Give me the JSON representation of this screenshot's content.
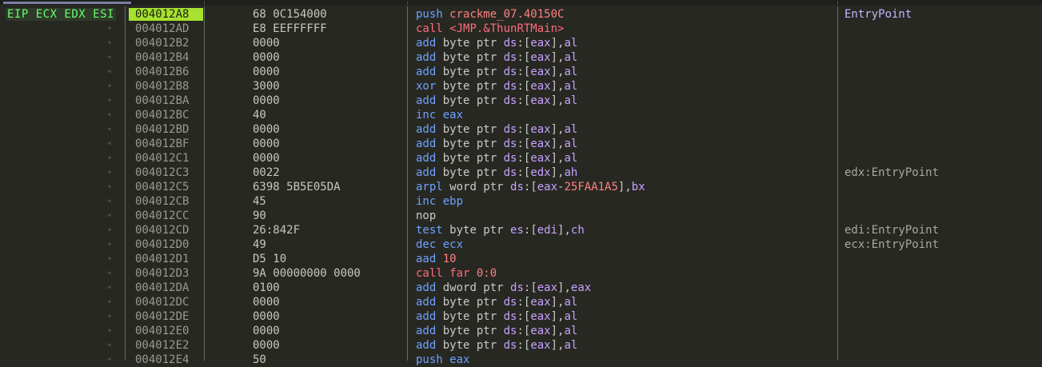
{
  "registers_label": "EIP ECX EDX ESI",
  "colors": {
    "background": "#272822",
    "current_address_highlight": "#a6e22e",
    "register_label": "#69ff6e",
    "mnemonic": "#6fa1ff",
    "call": "#ff6b7e",
    "segment_register": "#c8a2ff",
    "number": "#ff8080"
  },
  "rows": [
    {
      "addr": "004012A8",
      "bytes": "68 0C154000",
      "comment": "EntryPoint",
      "current": true,
      "tokens": [
        {
          "t": "push",
          "c": "mn"
        },
        {
          "t": " "
        },
        {
          "t": "crackme_07.40150C",
          "c": "sym"
        }
      ]
    },
    {
      "addr": "004012AD",
      "bytes": "E8 EEFFFFFF",
      "comment": "",
      "tokens": [
        {
          "t": "call",
          "c": "call"
        },
        {
          "t": " "
        },
        {
          "t": "<JMP.&ThunRTMain>",
          "c": "call"
        }
      ]
    },
    {
      "addr": "004012B2",
      "bytes": "0000",
      "comment": "",
      "tokens": [
        {
          "t": "add",
          "c": "mn"
        },
        {
          "t": " "
        },
        {
          "t": "byte ptr",
          "c": "sz"
        },
        {
          "t": " "
        },
        {
          "t": "ds",
          "c": "seg"
        },
        {
          "t": ":[",
          "c": "pun"
        },
        {
          "t": "eax",
          "c": "reg"
        },
        {
          "t": "],",
          "c": "pun"
        },
        {
          "t": "al",
          "c": "reg"
        }
      ]
    },
    {
      "addr": "004012B4",
      "bytes": "0000",
      "comment": "",
      "tokens": [
        {
          "t": "add",
          "c": "mn"
        },
        {
          "t": " "
        },
        {
          "t": "byte ptr",
          "c": "sz"
        },
        {
          "t": " "
        },
        {
          "t": "ds",
          "c": "seg"
        },
        {
          "t": ":[",
          "c": "pun"
        },
        {
          "t": "eax",
          "c": "reg"
        },
        {
          "t": "],",
          "c": "pun"
        },
        {
          "t": "al",
          "c": "reg"
        }
      ]
    },
    {
      "addr": "004012B6",
      "bytes": "0000",
      "comment": "",
      "tokens": [
        {
          "t": "add",
          "c": "mn"
        },
        {
          "t": " "
        },
        {
          "t": "byte ptr",
          "c": "sz"
        },
        {
          "t": " "
        },
        {
          "t": "ds",
          "c": "seg"
        },
        {
          "t": ":[",
          "c": "pun"
        },
        {
          "t": "eax",
          "c": "reg"
        },
        {
          "t": "],",
          "c": "pun"
        },
        {
          "t": "al",
          "c": "reg"
        }
      ]
    },
    {
      "addr": "004012B8",
      "bytes": "3000",
      "comment": "",
      "tokens": [
        {
          "t": "xor",
          "c": "mn"
        },
        {
          "t": " "
        },
        {
          "t": "byte ptr",
          "c": "sz"
        },
        {
          "t": " "
        },
        {
          "t": "ds",
          "c": "seg"
        },
        {
          "t": ":[",
          "c": "pun"
        },
        {
          "t": "eax",
          "c": "reg"
        },
        {
          "t": "],",
          "c": "pun"
        },
        {
          "t": "al",
          "c": "reg"
        }
      ]
    },
    {
      "addr": "004012BA",
      "bytes": "0000",
      "comment": "",
      "tokens": [
        {
          "t": "add",
          "c": "mn"
        },
        {
          "t": " "
        },
        {
          "t": "byte ptr",
          "c": "sz"
        },
        {
          "t": " "
        },
        {
          "t": "ds",
          "c": "seg"
        },
        {
          "t": ":[",
          "c": "pun"
        },
        {
          "t": "eax",
          "c": "reg"
        },
        {
          "t": "],",
          "c": "pun"
        },
        {
          "t": "al",
          "c": "reg"
        }
      ]
    },
    {
      "addr": "004012BC",
      "bytes": "40",
      "comment": "",
      "tokens": [
        {
          "t": "inc",
          "c": "mn"
        },
        {
          "t": " "
        },
        {
          "t": "eax",
          "c": "mn"
        }
      ]
    },
    {
      "addr": "004012BD",
      "bytes": "0000",
      "comment": "",
      "tokens": [
        {
          "t": "add",
          "c": "mn"
        },
        {
          "t": " "
        },
        {
          "t": "byte ptr",
          "c": "sz"
        },
        {
          "t": " "
        },
        {
          "t": "ds",
          "c": "seg"
        },
        {
          "t": ":[",
          "c": "pun"
        },
        {
          "t": "eax",
          "c": "reg"
        },
        {
          "t": "],",
          "c": "pun"
        },
        {
          "t": "al",
          "c": "reg"
        }
      ]
    },
    {
      "addr": "004012BF",
      "bytes": "0000",
      "comment": "",
      "tokens": [
        {
          "t": "add",
          "c": "mn"
        },
        {
          "t": " "
        },
        {
          "t": "byte ptr",
          "c": "sz"
        },
        {
          "t": " "
        },
        {
          "t": "ds",
          "c": "seg"
        },
        {
          "t": ":[",
          "c": "pun"
        },
        {
          "t": "eax",
          "c": "reg"
        },
        {
          "t": "],",
          "c": "pun"
        },
        {
          "t": "al",
          "c": "reg"
        }
      ]
    },
    {
      "addr": "004012C1",
      "bytes": "0000",
      "comment": "",
      "tokens": [
        {
          "t": "add",
          "c": "mn"
        },
        {
          "t": " "
        },
        {
          "t": "byte ptr",
          "c": "sz"
        },
        {
          "t": " "
        },
        {
          "t": "ds",
          "c": "seg"
        },
        {
          "t": ":[",
          "c": "pun"
        },
        {
          "t": "eax",
          "c": "reg"
        },
        {
          "t": "],",
          "c": "pun"
        },
        {
          "t": "al",
          "c": "reg"
        }
      ]
    },
    {
      "addr": "004012C3",
      "bytes": "0022",
      "comment": "edx:EntryPoint",
      "tokens": [
        {
          "t": "add",
          "c": "mn"
        },
        {
          "t": " "
        },
        {
          "t": "byte ptr",
          "c": "sz"
        },
        {
          "t": " "
        },
        {
          "t": "ds",
          "c": "seg"
        },
        {
          "t": ":[",
          "c": "pun"
        },
        {
          "t": "edx",
          "c": "reg"
        },
        {
          "t": "],",
          "c": "pun"
        },
        {
          "t": "ah",
          "c": "reg"
        }
      ]
    },
    {
      "addr": "004012C5",
      "bytes": "6398 5B5E05DA",
      "comment": "",
      "tokens": [
        {
          "t": "arpl",
          "c": "mn"
        },
        {
          "t": " "
        },
        {
          "t": "word ptr",
          "c": "sz"
        },
        {
          "t": " "
        },
        {
          "t": "ds",
          "c": "seg"
        },
        {
          "t": ":[",
          "c": "pun"
        },
        {
          "t": "eax",
          "c": "reg"
        },
        {
          "t": "-",
          "c": "pun"
        },
        {
          "t": "25FAA1A5",
          "c": "num"
        },
        {
          "t": "],",
          "c": "pun"
        },
        {
          "t": "bx",
          "c": "reg"
        }
      ]
    },
    {
      "addr": "004012CB",
      "bytes": "45",
      "comment": "",
      "tokens": [
        {
          "t": "inc",
          "c": "mn"
        },
        {
          "t": " "
        },
        {
          "t": "ebp",
          "c": "mn"
        }
      ]
    },
    {
      "addr": "004012CC",
      "bytes": "90",
      "comment": "",
      "tokens": [
        {
          "t": "nop",
          "c": "sz"
        }
      ]
    },
    {
      "addr": "004012CD",
      "bytes": "26:842F",
      "comment": "edi:EntryPoint",
      "tokens": [
        {
          "t": "test",
          "c": "mn"
        },
        {
          "t": " "
        },
        {
          "t": "byte ptr",
          "c": "sz"
        },
        {
          "t": " "
        },
        {
          "t": "es",
          "c": "seg"
        },
        {
          "t": ":[",
          "c": "pun"
        },
        {
          "t": "edi",
          "c": "reg"
        },
        {
          "t": "],",
          "c": "pun"
        },
        {
          "t": "ch",
          "c": "reg"
        }
      ]
    },
    {
      "addr": "004012D0",
      "bytes": "49",
      "comment": "ecx:EntryPoint",
      "tokens": [
        {
          "t": "dec",
          "c": "mn"
        },
        {
          "t": " "
        },
        {
          "t": "ecx",
          "c": "mn"
        }
      ]
    },
    {
      "addr": "004012D1",
      "bytes": "D5 10",
      "comment": "",
      "tokens": [
        {
          "t": "aad",
          "c": "mn"
        },
        {
          "t": " "
        },
        {
          "t": "10",
          "c": "num"
        }
      ]
    },
    {
      "addr": "004012D3",
      "bytes": "9A 00000000 0000",
      "comment": "",
      "tokens": [
        {
          "t": "call far",
          "c": "call"
        },
        {
          "t": " "
        },
        {
          "t": "0:0",
          "c": "num"
        }
      ]
    },
    {
      "addr": "004012DA",
      "bytes": "0100",
      "comment": "",
      "tokens": [
        {
          "t": "add",
          "c": "mn"
        },
        {
          "t": " "
        },
        {
          "t": "dword ptr",
          "c": "sz"
        },
        {
          "t": " "
        },
        {
          "t": "ds",
          "c": "seg"
        },
        {
          "t": ":[",
          "c": "pun"
        },
        {
          "t": "eax",
          "c": "reg"
        },
        {
          "t": "],",
          "c": "pun"
        },
        {
          "t": "eax",
          "c": "reg"
        }
      ]
    },
    {
      "addr": "004012DC",
      "bytes": "0000",
      "comment": "",
      "tokens": [
        {
          "t": "add",
          "c": "mn"
        },
        {
          "t": " "
        },
        {
          "t": "byte ptr",
          "c": "sz"
        },
        {
          "t": " "
        },
        {
          "t": "ds",
          "c": "seg"
        },
        {
          "t": ":[",
          "c": "pun"
        },
        {
          "t": "eax",
          "c": "reg"
        },
        {
          "t": "],",
          "c": "pun"
        },
        {
          "t": "al",
          "c": "reg"
        }
      ]
    },
    {
      "addr": "004012DE",
      "bytes": "0000",
      "comment": "",
      "tokens": [
        {
          "t": "add",
          "c": "mn"
        },
        {
          "t": " "
        },
        {
          "t": "byte ptr",
          "c": "sz"
        },
        {
          "t": " "
        },
        {
          "t": "ds",
          "c": "seg"
        },
        {
          "t": ":[",
          "c": "pun"
        },
        {
          "t": "eax",
          "c": "reg"
        },
        {
          "t": "],",
          "c": "pun"
        },
        {
          "t": "al",
          "c": "reg"
        }
      ]
    },
    {
      "addr": "004012E0",
      "bytes": "0000",
      "comment": "",
      "tokens": [
        {
          "t": "add",
          "c": "mn"
        },
        {
          "t": " "
        },
        {
          "t": "byte ptr",
          "c": "sz"
        },
        {
          "t": " "
        },
        {
          "t": "ds",
          "c": "seg"
        },
        {
          "t": ":[",
          "c": "pun"
        },
        {
          "t": "eax",
          "c": "reg"
        },
        {
          "t": "],",
          "c": "pun"
        },
        {
          "t": "al",
          "c": "reg"
        }
      ]
    },
    {
      "addr": "004012E2",
      "bytes": "0000",
      "comment": "",
      "tokens": [
        {
          "t": "add",
          "c": "mn"
        },
        {
          "t": " "
        },
        {
          "t": "byte ptr",
          "c": "sz"
        },
        {
          "t": " "
        },
        {
          "t": "ds",
          "c": "seg"
        },
        {
          "t": ":[",
          "c": "pun"
        },
        {
          "t": "eax",
          "c": "reg"
        },
        {
          "t": "],",
          "c": "pun"
        },
        {
          "t": "al",
          "c": "reg"
        }
      ]
    },
    {
      "addr": "004012E4",
      "bytes": "50",
      "comment": "",
      "tokens": [
        {
          "t": "push",
          "c": "mn"
        },
        {
          "t": " "
        },
        {
          "t": "eax",
          "c": "mn"
        }
      ]
    }
  ]
}
